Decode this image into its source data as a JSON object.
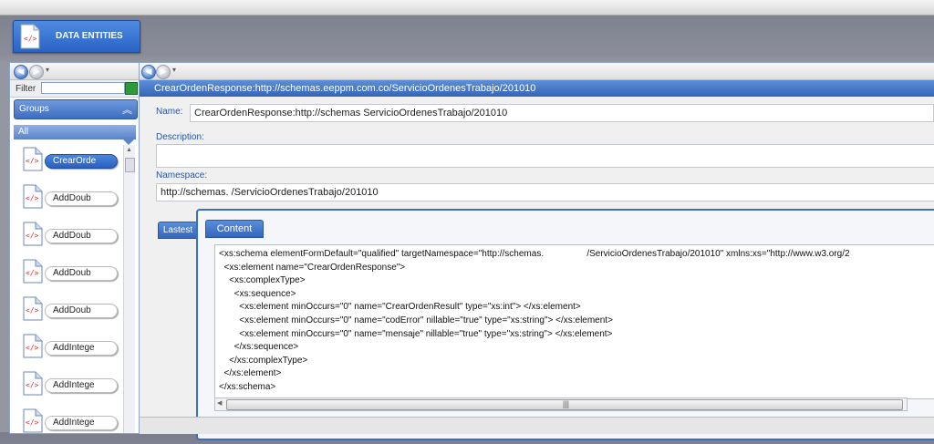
{
  "app": {
    "entity_tab_label": "DATA ENTITIES"
  },
  "left_panel": {
    "filter_label": "Filter",
    "filter_value": "",
    "groups_label": "Groups",
    "all_label": "All",
    "items": [
      {
        "label": "CrearOrde",
        "selected": true
      },
      {
        "label": "AddDoub",
        "selected": false
      },
      {
        "label": "AddDoub",
        "selected": false
      },
      {
        "label": "AddDoub",
        "selected": false
      },
      {
        "label": "AddDoub",
        "selected": false
      },
      {
        "label": "AddIntege",
        "selected": false
      },
      {
        "label": "AddIntege",
        "selected": false
      },
      {
        "label": "AddIntege",
        "selected": false
      }
    ]
  },
  "detail": {
    "title": "CrearOrdenResponse:http://schemas.eeppm.com.co/ServicioOrdenesTrabajo/201010",
    "name_label": "Name:",
    "name_value": "CrearOrdenResponse:http://schemas                 ServicioOrdenesTrabajo/201010",
    "description_label": "Description:",
    "description_value": "",
    "namespace_label": "Namespace:",
    "namespace_value": "http://schemas.               /ServicioOrdenesTrabajo/201010",
    "lastest_tab": "Lastest",
    "content_tab": "Content",
    "content_lines": [
      "<xs:schema elementFormDefault=\"qualified\" targetNamespace=\"http://schemas.                 /ServicioOrdenesTrabajo/201010\" xmlns:xs=\"http://www.w3.org/2",
      "  <xs:element name=\"CrearOrdenResponse\">",
      "    <xs:complexType>",
      "      <xs:sequence>",
      "        <xs:element minOccurs=\"0\" name=\"CrearOrdenResult\" type=\"xs:int\"> </xs:element>",
      "        <xs:element minOccurs=\"0\" name=\"codError\" nillable=\"true\" type=\"xs:string\"> </xs:element>",
      "        <xs:element minOccurs=\"0\" name=\"mensaje\" nillable=\"true\" type=\"xs:string\"> </xs:element>",
      "      </xs:sequence>",
      "    </xs:complexType>",
      "  </xs:element>",
      "</xs:schema>"
    ]
  },
  "icons": {
    "back": "back-arrow-icon",
    "forward": "forward-arrow-icon",
    "document": "xml-document-icon"
  },
  "colors": {
    "accent": "#3565b8",
    "label": "#2b56a8"
  }
}
